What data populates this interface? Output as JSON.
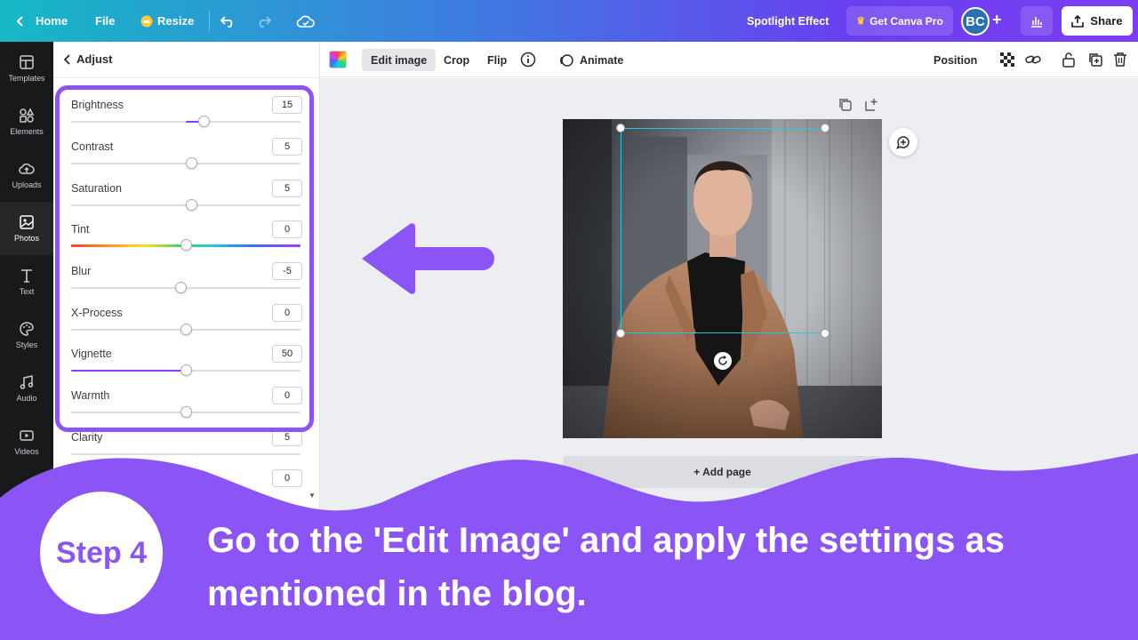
{
  "topbar": {
    "home_label": "Home",
    "file_label": "File",
    "resize_label": "Resize",
    "doc_title": "Spotlight Effect",
    "pro_label": "Get Canva Pro",
    "avatar_initials": "BC",
    "share_label": "Share"
  },
  "rail": {
    "items": [
      {
        "label": "Templates",
        "icon": "templates-icon"
      },
      {
        "label": "Elements",
        "icon": "elements-icon"
      },
      {
        "label": "Uploads",
        "icon": "uploads-icon"
      },
      {
        "label": "Photos",
        "icon": "photos-icon"
      },
      {
        "label": "Text",
        "icon": "text-icon"
      },
      {
        "label": "Styles",
        "icon": "styles-icon"
      },
      {
        "label": "Audio",
        "icon": "audio-icon"
      },
      {
        "label": "Videos",
        "icon": "videos-icon"
      }
    ],
    "active_index": 3
  },
  "panel": {
    "back_label": "Adjust",
    "adjustments": [
      {
        "label": "Brightness",
        "value": "15"
      },
      {
        "label": "Contrast",
        "value": "5"
      },
      {
        "label": "Saturation",
        "value": "5"
      },
      {
        "label": "Tint",
        "value": "0"
      },
      {
        "label": "Blur",
        "value": "-5"
      },
      {
        "label": "X-Process",
        "value": "0"
      },
      {
        "label": "Vignette",
        "value": "50"
      },
      {
        "label": "Warmth",
        "value": "0"
      },
      {
        "label": "Clarity",
        "value": "5"
      },
      {
        "label": "",
        "value": "0"
      }
    ]
  },
  "toolbar": {
    "edit_image_label": "Edit image",
    "crop_label": "Crop",
    "flip_label": "Flip",
    "animate_label": "Animate",
    "position_label": "Position"
  },
  "canvas": {
    "add_page_label": "+ Add page"
  },
  "banner": {
    "step_label": "Step 4",
    "instruction": "Go to the 'Edit Image' and apply the settings as mentioned in the blog."
  },
  "colors": {
    "accent": "#8b55f6",
    "selection": "#2fc1e0",
    "rail_bg": "#18191b"
  }
}
